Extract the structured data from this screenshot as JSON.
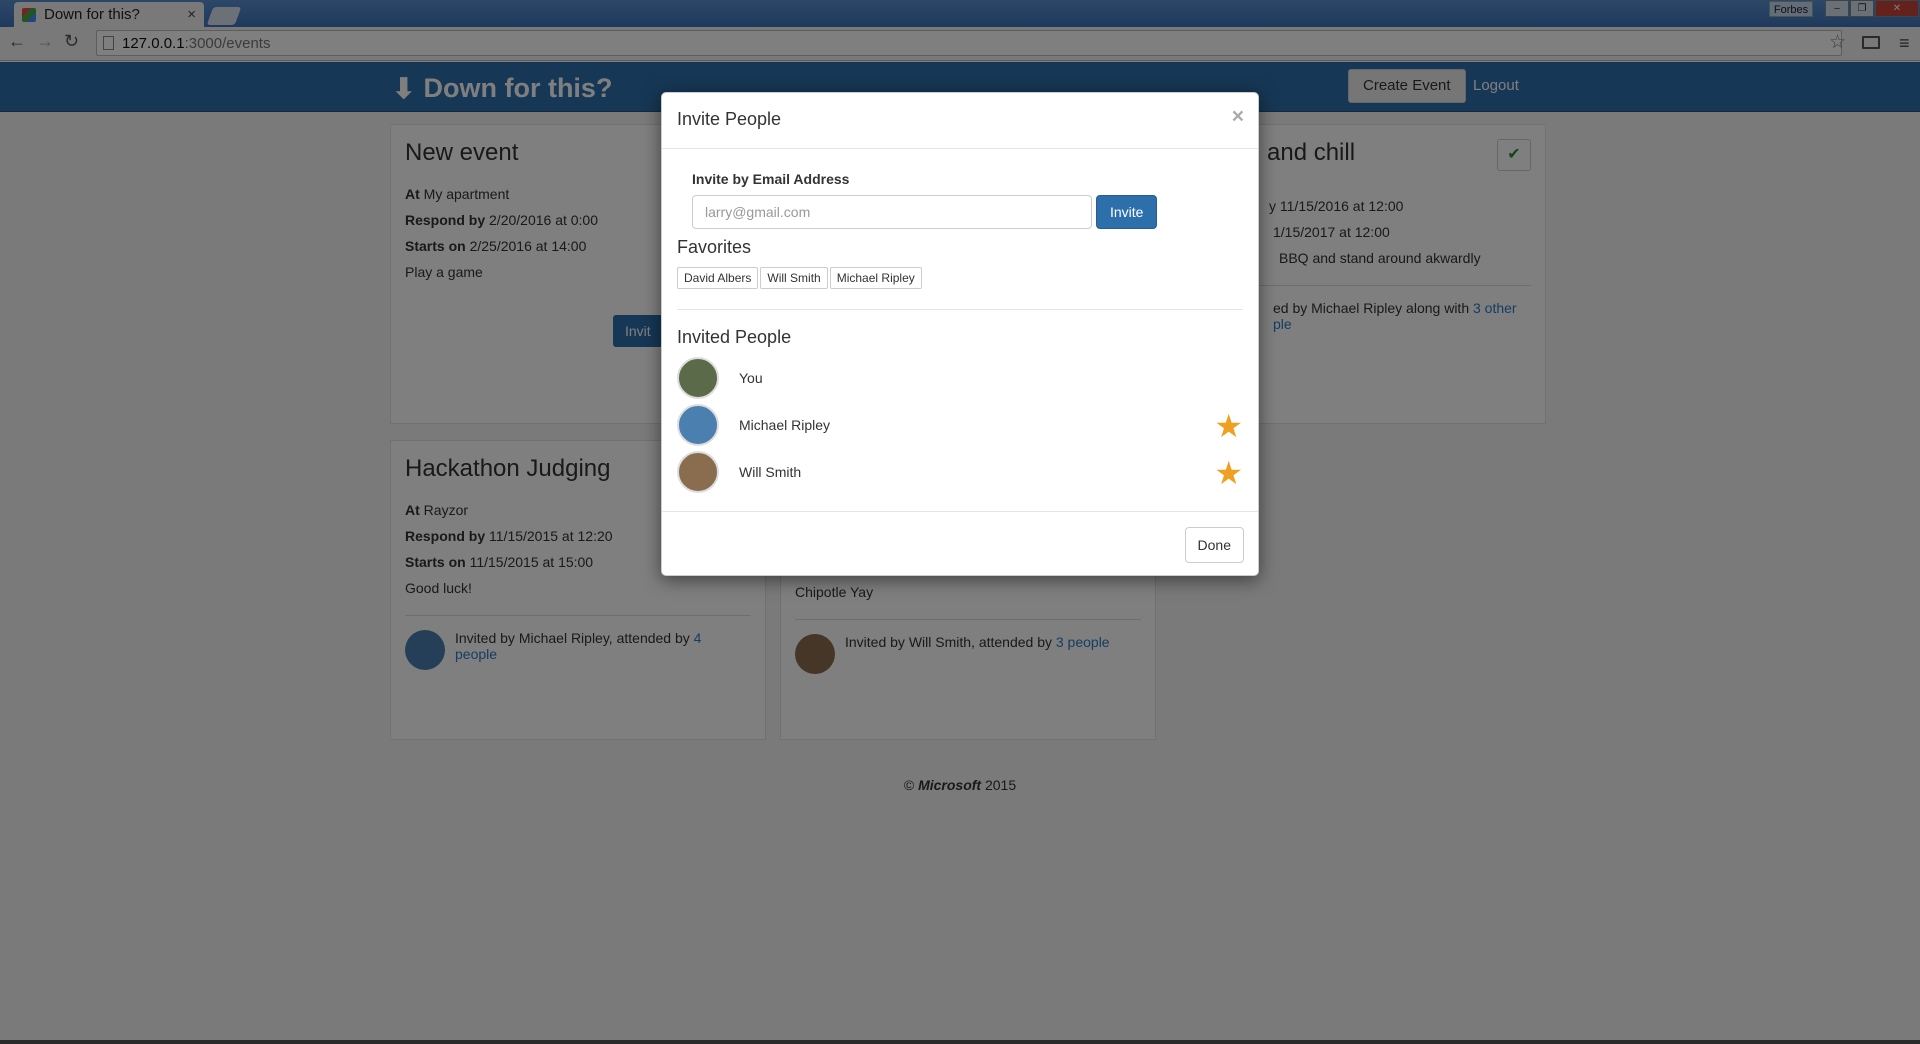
{
  "browser": {
    "tab_title": "Down for this?",
    "tab_close": "×",
    "profile_name": "Forbes",
    "url_host": "127.0.0.1",
    "url_path": ":3000/events",
    "back_glyph": "←",
    "forward_glyph": "→",
    "reload_glyph": "↻",
    "bookmark_glyph": "☆",
    "menu_glyph": "≡",
    "window_buttons": {
      "minimize": "‒",
      "maximize": "❐",
      "close": "✕"
    }
  },
  "navbar": {
    "brand": "Down for this?",
    "brand_icon": "down-arrow-icon",
    "brand_glyph": "⬇",
    "create_event_label": "Create Event",
    "logout_label": "Logout"
  },
  "events": [
    {
      "title": "New event",
      "at_label": "At",
      "at": "My apartment",
      "respond_label": "Respond by",
      "respond": "2/20/2016 at 0:00",
      "starts_label": "Starts on",
      "starts": "2/25/2016 at 14:00",
      "description": "Play a game",
      "button_label": "Invit"
    },
    {
      "title": "and chill",
      "respond_partial": "y 11/15/2016 at 12:00",
      "starts_partial": "1/15/2017 at 12:00",
      "description_partial": "BBQ and stand around akwardly",
      "footer_text": "ed by Michael Ripley along with ",
      "footer_link": "3 other",
      "footer_link2": "ple",
      "check_glyph": "✔"
    },
    {
      "title": "Hackathon Judging",
      "at_label": "At",
      "at": "Rayzor",
      "respond_label": "Respond by",
      "respond": "11/15/2015 at 12:20",
      "starts_label": "Starts on",
      "starts": "11/15/2015 at 15:00",
      "description": "Good luck!",
      "footer_text": "Invited by Michael Ripley, attended by ",
      "footer_link": "4 people"
    },
    {
      "description": "Chipotle Yay",
      "footer_text": "Invited by Will Smith, attended by ",
      "footer_link": "3 people"
    }
  ],
  "footer": {
    "copyright": "©",
    "company": "Microsoft",
    "year": "2015"
  },
  "modal": {
    "title": "Invite People",
    "close": "×",
    "email_label": "Invite by Email Address",
    "email_placeholder": "larry@gmail.com",
    "invite_label": "Invite",
    "favorites_heading": "Favorites",
    "favorites": [
      "David Albers",
      "Will Smith",
      "Michael Ripley"
    ],
    "invited_heading": "Invited People",
    "invited": [
      {
        "name": "You",
        "favorite": false,
        "avatar_color": "#5b6b4a"
      },
      {
        "name": "Michael Ripley",
        "favorite": true,
        "avatar_color": "#4b7fb0"
      },
      {
        "name": "Will Smith",
        "favorite": true,
        "avatar_color": "#8a6d4e"
      }
    ],
    "star_glyph": "★",
    "done_label": "Done"
  }
}
